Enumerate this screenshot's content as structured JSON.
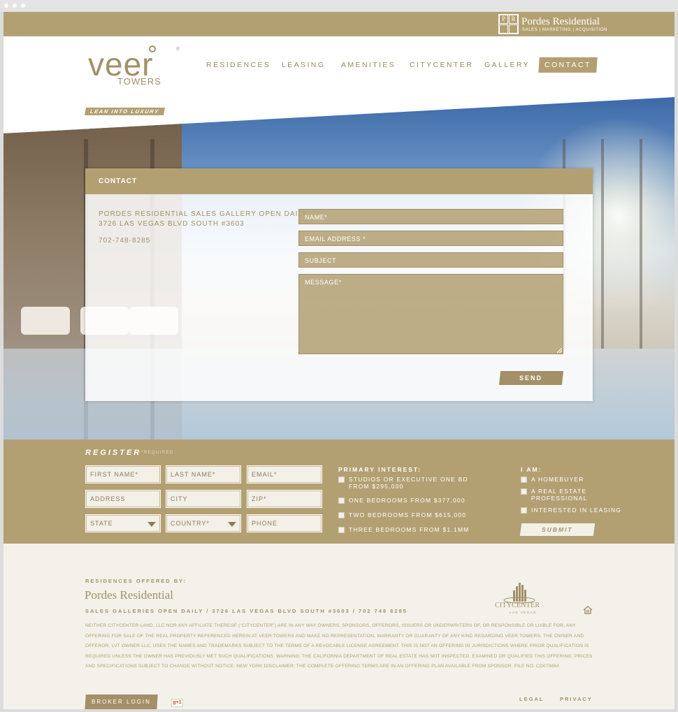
{
  "colors": {
    "gold": "#b3a072",
    "gold_dark": "#a39068",
    "cream": "#f3f1ea"
  },
  "topbar": {
    "brand_name": "Pordes Residential",
    "brand_tagline": "SALES | MARKETING | ACQUISITION",
    "logo_letters": [
      "P",
      "R"
    ]
  },
  "header": {
    "logo_word": "veer",
    "logo_reg": "®",
    "logo_sub": "TOWERS",
    "tagline": "LEAN INTO LUXURY",
    "nav": [
      {
        "label": "RESIDENCES"
      },
      {
        "label": "LEASING"
      },
      {
        "label": "AMENITIES"
      },
      {
        "label": "CITYCENTER"
      },
      {
        "label": "GALLERY"
      },
      {
        "label": "CONTACT",
        "active": true
      }
    ]
  },
  "contact": {
    "title": "CONTACT",
    "gallery_line": "PORDES RESIDENTIAL SALES GALLERY OPEN DAILY",
    "address": "3726 LAS VEGAS BLVD SOUTH #3603",
    "phone": "702-748-8285",
    "fields": {
      "name": "NAME*",
      "email": "EMAIL ADDRESS *",
      "subject": "SUBJECT",
      "message": "MESSAGE*"
    },
    "send_label": "SEND"
  },
  "register": {
    "title": "REGISTER",
    "required_note": "*REQUIRED",
    "inputs": {
      "first_name": "FIRST NAME*",
      "last_name": "LAST NAME*",
      "email": "EMAIL*",
      "address": "ADDRESS",
      "city": "CITY",
      "zip": "ZIP*",
      "state": "STATE",
      "country": "COUNTRY*",
      "phone": "PHONE"
    },
    "primary_interest": {
      "title": "PRIMARY INTEREST:",
      "options": [
        "STUDIOS OR EXECUTIVE ONE BD",
        "FROM $295,000",
        "ONE BEDROOMS FROM $377,000",
        "TWO BEDROOMS FROM $615,000",
        "THREE BEDROOMS FROM $1.1MM"
      ]
    },
    "i_am": {
      "title": "I AM:",
      "options": [
        "A HOMEBUYER",
        "A REAL ESTATE",
        "PROFESSIONAL",
        "INTERESTED IN LEASING"
      ]
    },
    "submit_label": "SUBMIT"
  },
  "footer": {
    "offered_by": "RESIDENCES OFFERED BY:",
    "brand": "Pordes Residential",
    "galleries": "SALES GALLERIES OPEN DAILY / 3726 LAS VEGAS BLVD SOUTH #3603 / 702 748 8285",
    "legal_text": "Neither CityCenter Land, LLC nor any affiliate thereof (\"CityCenter\") are in any way owners, sponsors, offerors, issuers or underwriters of, or responsible or liable for, any offering for sale of the real property referenced herein at Veer Towers and make no representation, warranty or guaranty of any kind regarding Veer Towers. The owner and offeror, LVT Owner LLC, uses the names and trademarks subject to the terms of a revocable license agreement. This is not an offering in jurisdictions where prior qualification is required unless the owner has previously met such qualifications. Warning: The California Department of Real Estate has not inspected, examined or qualified this offering. Prices and specifications subject to change without notice. New York Disclaimer: The complete offering terms are in an offering plan available from sponsor. File No. CD070664.",
    "citycenter_word": "CITYCENTER",
    "citycenter_sub": "LAS VEGAS",
    "broker_login": "BROKER LOGIN",
    "gplus": "g+1",
    "legal_link": "LEGAL",
    "privacy_link": "PRIVACY"
  }
}
